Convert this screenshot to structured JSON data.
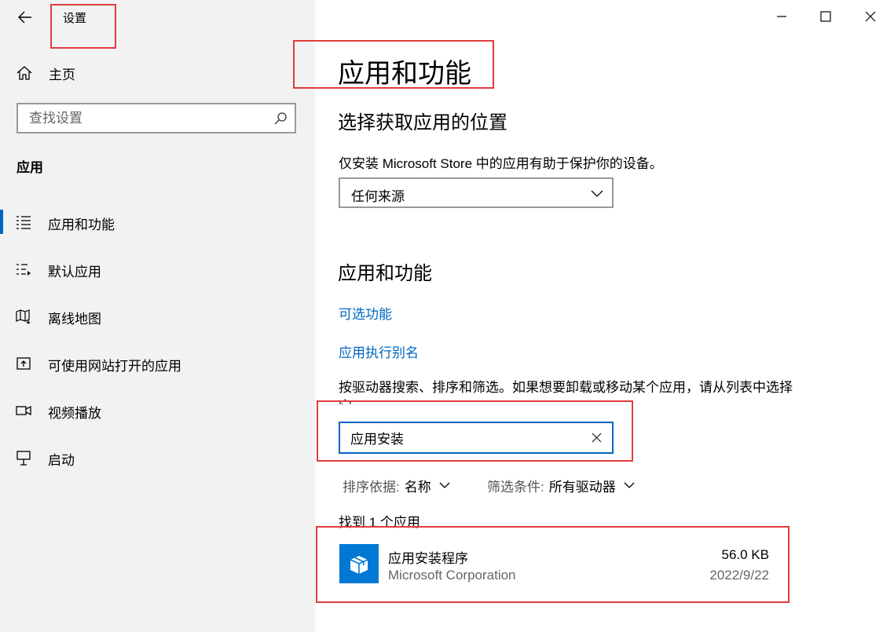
{
  "window": {
    "title": "设置",
    "controls": [
      "minimize",
      "maximize",
      "close"
    ]
  },
  "sidebar": {
    "home_label": "主页",
    "search_placeholder": "查找设置",
    "section_heading": "应用",
    "items": [
      {
        "label": "应用和功能",
        "icon": "apps-list-icon",
        "active": true
      },
      {
        "label": "默认应用",
        "icon": "default-apps-icon",
        "active": false
      },
      {
        "label": "离线地图",
        "icon": "offline-map-icon",
        "active": false
      },
      {
        "label": "可使用网站打开的应用",
        "icon": "apps-for-websites-icon",
        "active": false
      },
      {
        "label": "视频播放",
        "icon": "video-playback-icon",
        "active": false
      },
      {
        "label": "启动",
        "icon": "startup-icon",
        "active": false
      }
    ]
  },
  "main": {
    "page_title": "应用和功能",
    "install_source": {
      "heading": "选择获取应用的位置",
      "description": "仅安装 Microsoft Store 中的应用有助于保护你的设备。",
      "dropdown_value": "任何来源"
    },
    "apps_features": {
      "heading": "应用和功能",
      "link_optional": "可选功能",
      "link_alias": "应用执行别名",
      "description": "按驱动器搜索、排序和筛选。如果想要卸载或移动某个应用，请从列表中选择它。",
      "search_value": "应用安装",
      "sort_key": "排序依据:",
      "sort_value": "名称",
      "filter_key": "筛选条件:",
      "filter_value": "所有驱动器",
      "result_count": "找到 1 个应用",
      "apps": [
        {
          "name": "应用安装程序",
          "publisher": "Microsoft Corporation",
          "size": "56.0 KB",
          "date": "2022/9/22"
        }
      ]
    }
  },
  "colors": {
    "accent": "#0067c0",
    "sidebar_bg": "#f2f2f2",
    "annotation": "#e03c3c",
    "app_tile": "#0078d4"
  }
}
